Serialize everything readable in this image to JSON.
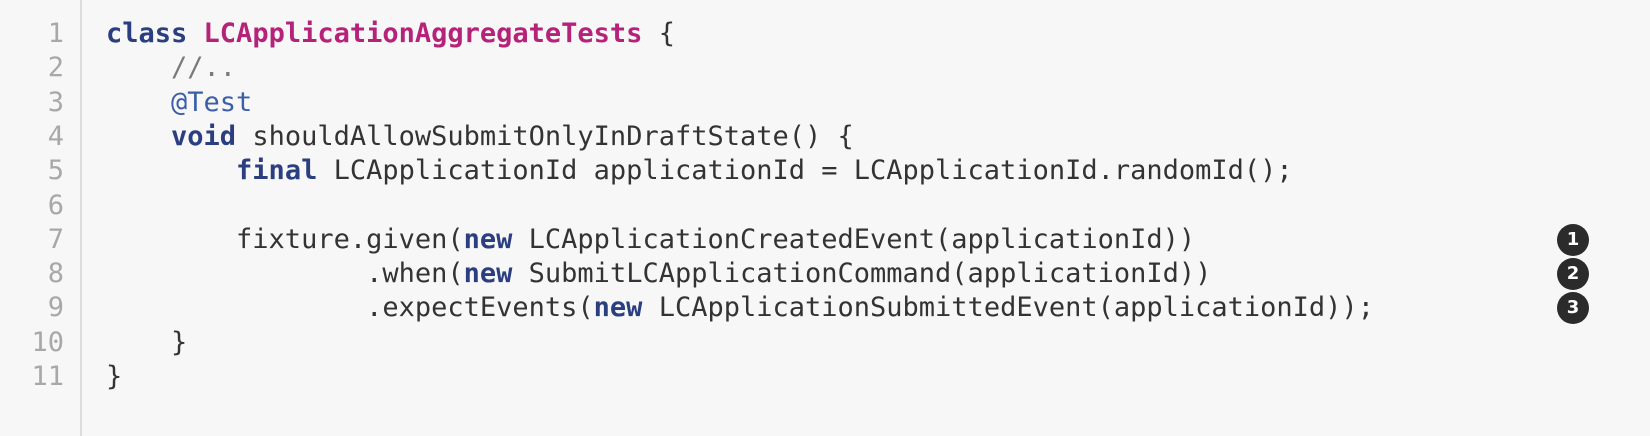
{
  "code_view": {
    "language": "java",
    "colors": {
      "background": "#f7f7f7",
      "line_number": "#a8a8a8",
      "keyword": "#2a3e80",
      "class_name": "#b5227a",
      "text": "#333333",
      "callout": "#2b2b2b"
    },
    "lines": [
      {
        "number": "1",
        "tokens": [
          {
            "t": "kw",
            "v": "class"
          },
          {
            "t": "plain",
            "v": " "
          },
          {
            "t": "cls",
            "v": "LCApplicationAggregateTests"
          },
          {
            "t": "plain",
            "v": " {"
          }
        ]
      },
      {
        "number": "2",
        "tokens": [
          {
            "t": "cm",
            "v": "    //.."
          }
        ]
      },
      {
        "number": "3",
        "tokens": [
          {
            "t": "plain",
            "v": "    "
          },
          {
            "t": "an",
            "v": "@Test"
          }
        ]
      },
      {
        "number": "4",
        "tokens": [
          {
            "t": "plain",
            "v": "    "
          },
          {
            "t": "kw",
            "v": "void"
          },
          {
            "t": "plain",
            "v": " shouldAllowSubmitOnlyInDraftState() {"
          }
        ]
      },
      {
        "number": "5",
        "tokens": [
          {
            "t": "plain",
            "v": "        "
          },
          {
            "t": "kw",
            "v": "final"
          },
          {
            "t": "plain",
            "v": " LCApplicationId applicationId = LCApplicationId.randomId();"
          }
        ]
      },
      {
        "number": "6",
        "tokens": []
      },
      {
        "number": "7",
        "tokens": [
          {
            "t": "plain",
            "v": "        fixture.given("
          },
          {
            "t": "kw",
            "v": "new"
          },
          {
            "t": "plain",
            "v": " LCApplicationCreatedEvent(applicationId))"
          }
        ],
        "callout": "1"
      },
      {
        "number": "8",
        "tokens": [
          {
            "t": "plain",
            "v": "                .when("
          },
          {
            "t": "kw",
            "v": "new"
          },
          {
            "t": "plain",
            "v": " SubmitLCApplicationCommand(applicationId))"
          }
        ],
        "callout": "2"
      },
      {
        "number": "9",
        "tokens": [
          {
            "t": "plain",
            "v": "                .expectEvents("
          },
          {
            "t": "kw",
            "v": "new"
          },
          {
            "t": "plain",
            "v": " LCApplicationSubmittedEvent(applicationId));"
          }
        ],
        "callout": "3"
      },
      {
        "number": "10",
        "tokens": [
          {
            "t": "plain",
            "v": "    }"
          }
        ]
      },
      {
        "number": "11",
        "tokens": [
          {
            "t": "plain",
            "v": "}"
          }
        ]
      }
    ]
  }
}
